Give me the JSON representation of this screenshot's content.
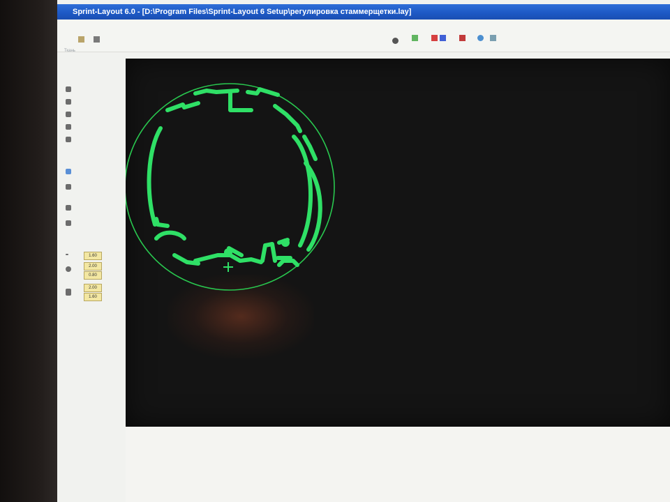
{
  "window": {
    "title": "Sprint-Layout 6.0 - [D:\\Program Files\\Sprint-Layout 6 Setup\\регулировка стаммерщетки.lay]"
  },
  "toolbar": {
    "icons": [
      "arrow-icon",
      "undo-icon",
      "zoom-icon",
      "layer-icon",
      "color-icon",
      "color-icon",
      "tag-icon",
      "help-icon"
    ]
  },
  "status": {
    "text": "Ткань"
  },
  "left_toolbox": {
    "values": [
      "1.60",
      "2.00",
      "0.80",
      "2.00",
      "1.60"
    ]
  },
  "board": {
    "trace_color": "#2fe066",
    "outline_color": "#29c84f",
    "background": "#141414"
  }
}
